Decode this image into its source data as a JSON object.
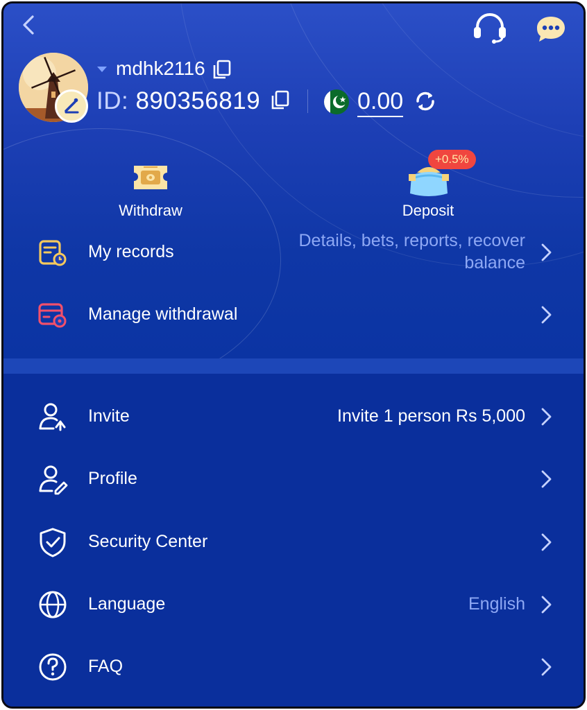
{
  "header": {
    "username": "mdhk2116",
    "id_label": "ID:",
    "id_value": "890356819",
    "balance": "0.00",
    "currency_flag": "pakistan-flag"
  },
  "actions": {
    "withdraw_label": "Withdraw",
    "deposit_label": "Deposit",
    "deposit_bonus": "+0.5%"
  },
  "menu_top": [
    {
      "label": "My records",
      "value": "Details, bets, reports, recover balance",
      "icon": "records-icon"
    },
    {
      "label": "Manage withdrawal",
      "value": "",
      "icon": "manage-withdrawal-icon"
    }
  ],
  "menu_bottom": [
    {
      "label": "Invite",
      "value": "Invite 1 person Rs 5,000",
      "icon": "invite-icon"
    },
    {
      "label": "Profile",
      "value": "",
      "icon": "profile-icon"
    },
    {
      "label": "Security Center",
      "value": "",
      "icon": "shield-icon"
    },
    {
      "label": "Language",
      "value": "English",
      "icon": "globe-icon"
    },
    {
      "label": "FAQ",
      "value": "",
      "icon": "question-icon"
    }
  ],
  "colors": {
    "background": "#0a2f9c",
    "header_top": "#2b4fc7",
    "muted_text": "#8ea8f4",
    "badge_red": "#f0463f",
    "gold": "#f6d27a"
  }
}
